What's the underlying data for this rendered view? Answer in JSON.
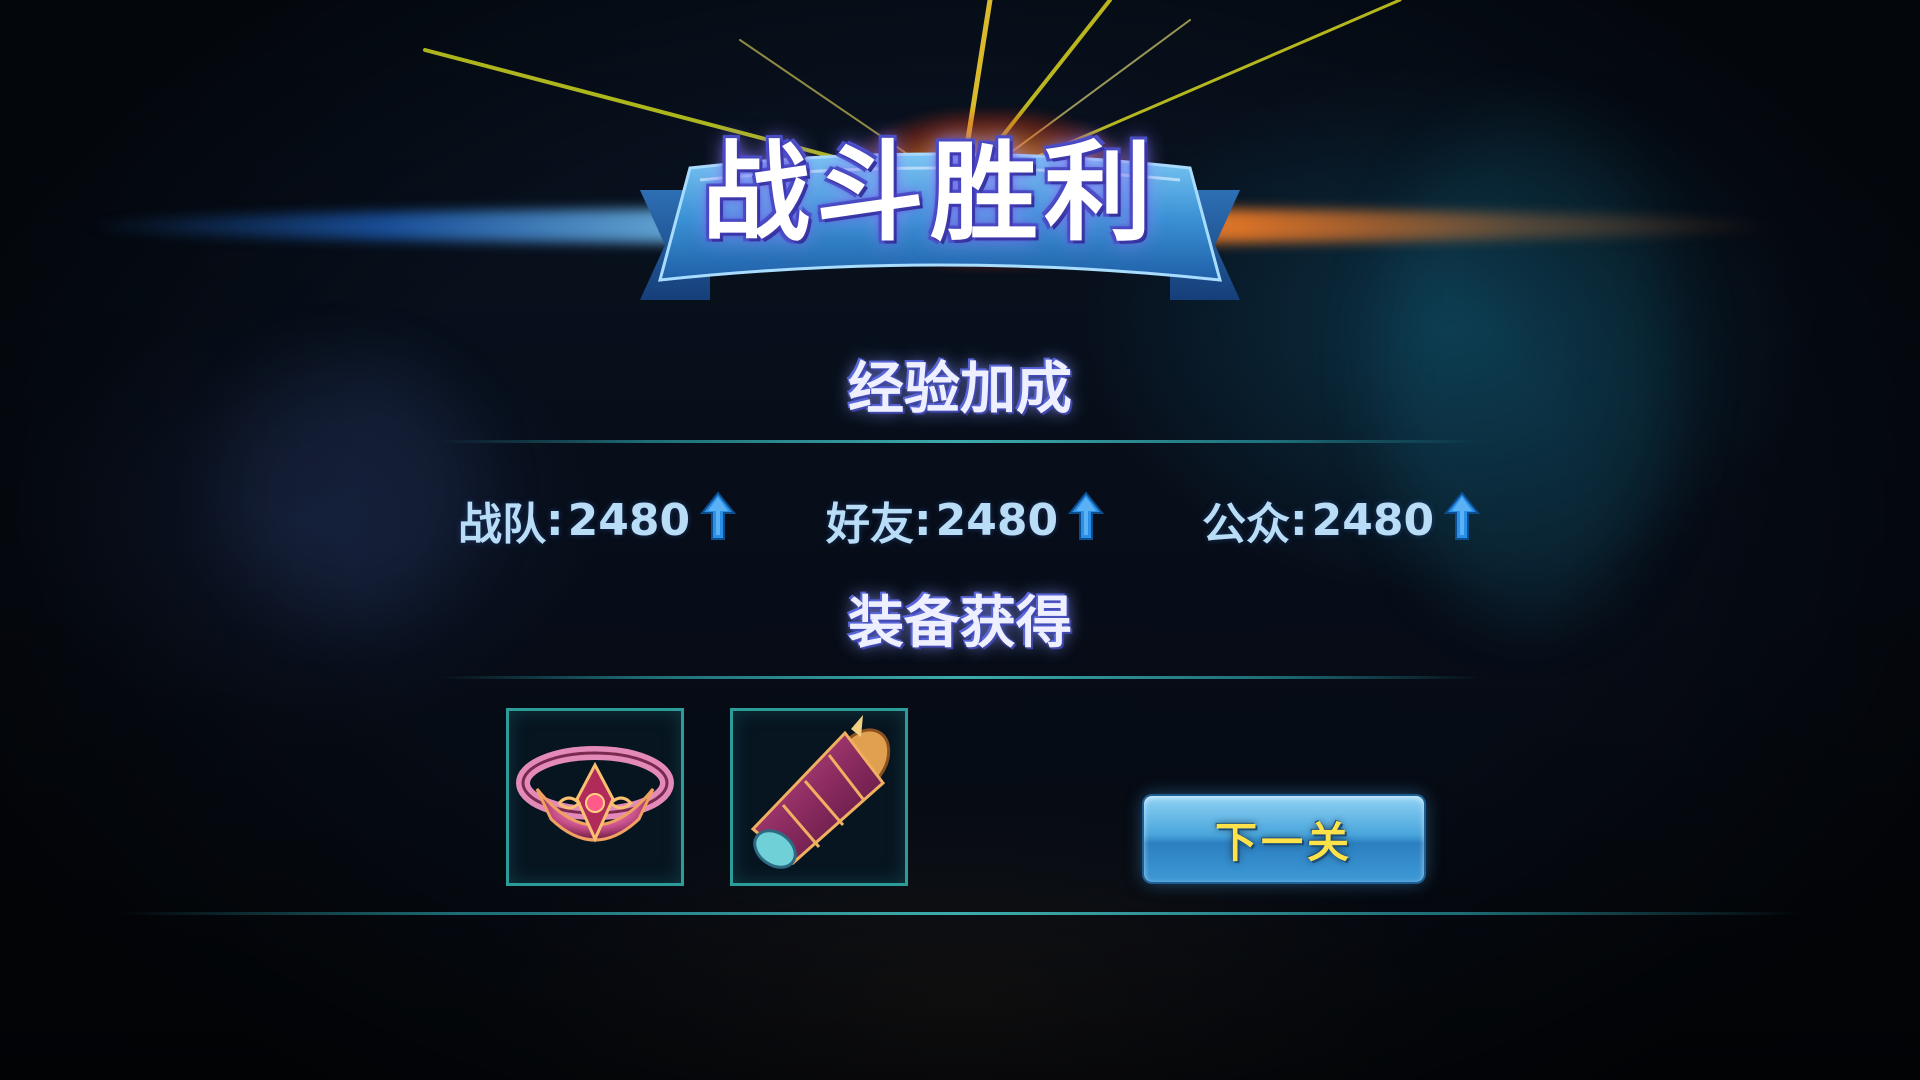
{
  "banner": {
    "title": "战斗胜利"
  },
  "exp_section": {
    "title": "经验加成",
    "stats": [
      {
        "label": "战队",
        "value": "2480",
        "trend": "up"
      },
      {
        "label": "好友",
        "value": "2480",
        "trend": "up"
      },
      {
        "label": "公众",
        "value": "2480",
        "trend": "up"
      }
    ],
    "separator": ":"
  },
  "equip_section": {
    "title": "装备获得",
    "items": [
      {
        "icon": "ring-icon"
      },
      {
        "icon": "bracer-icon"
      }
    ]
  },
  "next_button": {
    "label": "下一关"
  },
  "colors": {
    "title_glow": "#5a4ad8",
    "stat_text": "#b9ddf7",
    "divider": "#2b9c98",
    "button_text": "#ffe24a",
    "button_bg": "#4aa6dc"
  }
}
